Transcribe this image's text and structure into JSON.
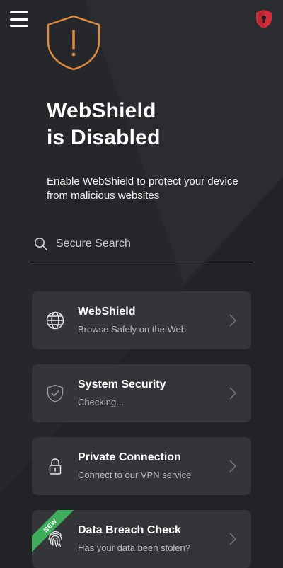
{
  "header": {
    "menu_icon": "hamburger-menu-icon",
    "brand_icon": "brand-shield-keyhole-icon"
  },
  "hero": {
    "icon": "shield-warning-icon",
    "title_line1": "WebShield",
    "title_line2": "is Disabled",
    "subtitle": "Enable WebShield to protect your device from malicious websites"
  },
  "search": {
    "icon": "search-icon",
    "placeholder": "Secure Search",
    "value": ""
  },
  "cards": [
    {
      "title": "WebShield",
      "subtitle": "Browse Safely on the Web",
      "icon": "globe-icon"
    },
    {
      "title": "System Security",
      "subtitle": "Checking...",
      "icon": "shield-check-icon"
    },
    {
      "title": "Private Connection",
      "subtitle": "Connect to our VPN service",
      "icon": "lock-icon"
    },
    {
      "title": "Data Breach Check",
      "subtitle": "Has your data been stolen?",
      "icon": "fingerprint-icon",
      "badge": "NEW"
    }
  ],
  "colors": {
    "background": "#26272a",
    "card": "#333538",
    "warning_orange": "#e08a3c",
    "brand_red": "#d32f3a",
    "new_badge_green": "#3fae5a"
  }
}
